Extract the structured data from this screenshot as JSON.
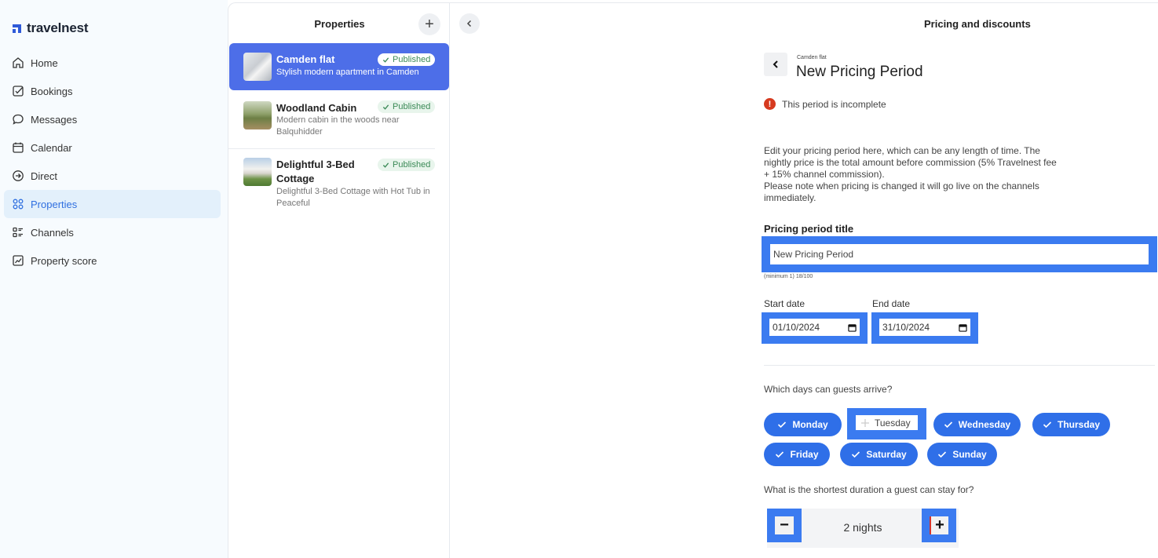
{
  "brand": {
    "name": "travelnest",
    "color": "#2f5ad8"
  },
  "nav": {
    "items": [
      {
        "label": "Home",
        "icon": "home-icon"
      },
      {
        "label": "Bookings",
        "icon": "checkbox-icon"
      },
      {
        "label": "Messages",
        "icon": "chat-bubble-icon"
      },
      {
        "label": "Calendar",
        "icon": "calendar-icon"
      },
      {
        "label": "Direct",
        "icon": "arrow-circle-icon"
      },
      {
        "label": "Properties",
        "icon": "grid-icon",
        "active": true
      },
      {
        "label": "Channels",
        "icon": "list-icon"
      },
      {
        "label": "Property score",
        "icon": "chart-icon"
      }
    ]
  },
  "properties": {
    "title": "Properties",
    "add_label": "+",
    "list": [
      {
        "name": "Camden flat",
        "desc": "Stylish modern apartment in Camden",
        "status": "Published",
        "selected": true
      },
      {
        "name": "Woodland Cabin",
        "desc": "Modern cabin in the woods near Balquhidder",
        "status": "Published"
      },
      {
        "name": "Delightful 3-Bed Cottage",
        "desc": "Delightful 3-Bed Cottage with Hot Tub in Peaceful",
        "status": "Published"
      }
    ]
  },
  "main": {
    "title": "Pricing and discounts",
    "breadcrumb": "Camden flat",
    "heading": "New Pricing Period",
    "warning": "This period is incomplete",
    "intro": [
      "Edit your pricing period here, which can be any length of time. The nightly price is the total amount before commission (5% Travelnest fee + 15% channel commission).",
      "Please note when pricing is changed it will go live on the channels immediately."
    ],
    "title_field": {
      "label": "Pricing period title",
      "value": "New Pricing Period",
      "counter": "(minimum 1) 18/100"
    },
    "start_date": {
      "label": "Start date",
      "value": "01/10/2024"
    },
    "end_date": {
      "label": "End date",
      "value": "31/10/2024"
    },
    "arrival_question": "Which days can guests arrive?",
    "days": [
      {
        "label": "Monday",
        "selected": true
      },
      {
        "label": "Tuesday",
        "selected": false
      },
      {
        "label": "Wednesday",
        "selected": true
      },
      {
        "label": "Thursday",
        "selected": true
      },
      {
        "label": "Friday",
        "selected": true
      },
      {
        "label": "Saturday",
        "selected": true
      },
      {
        "label": "Sunday",
        "selected": true
      }
    ],
    "min_stay_question": "What is the shortest duration a guest can stay for?",
    "min_stay": {
      "value": "2 nights",
      "minus": "−",
      "plus": "+"
    }
  },
  "colors": {
    "accent": "#2f6fe8",
    "highlight": "#3b7bf0",
    "selected_card": "#4d6ee8",
    "warning": "#d63a1f",
    "published_green": "#3b8a57"
  }
}
